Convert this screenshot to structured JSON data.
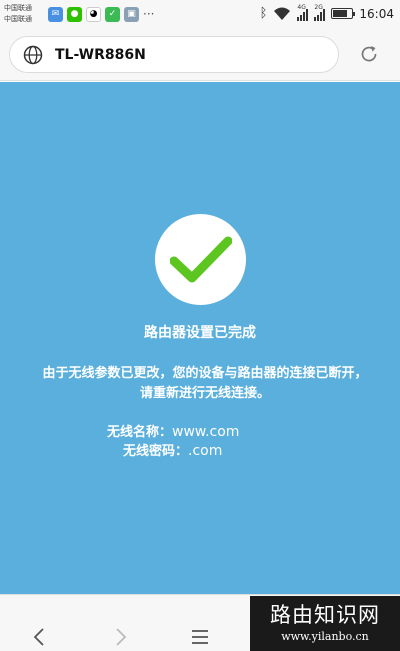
{
  "status_bar": {
    "carrier_line1": "中国联通",
    "carrier_line2": "中国联通",
    "network_1": "4G",
    "network_2": "2G",
    "clock": "16:04",
    "more_icon": "···"
  },
  "browser": {
    "url": "TL-WR886N"
  },
  "page": {
    "title": "路由器设置已完成",
    "message": "由于无线参数已更改，您的设备与路由器的连接已断开，请重新进行无线连接。",
    "ssid_label": "无线名称：",
    "ssid_value": "www.com",
    "password_label": "无线密码：",
    "password_value": ".com"
  },
  "watermark": {
    "title": "路由知识网",
    "url": "www.yilanbo.cn"
  },
  "colors": {
    "content_bg": "#5aafdc",
    "check_green": "#5cc51f"
  }
}
